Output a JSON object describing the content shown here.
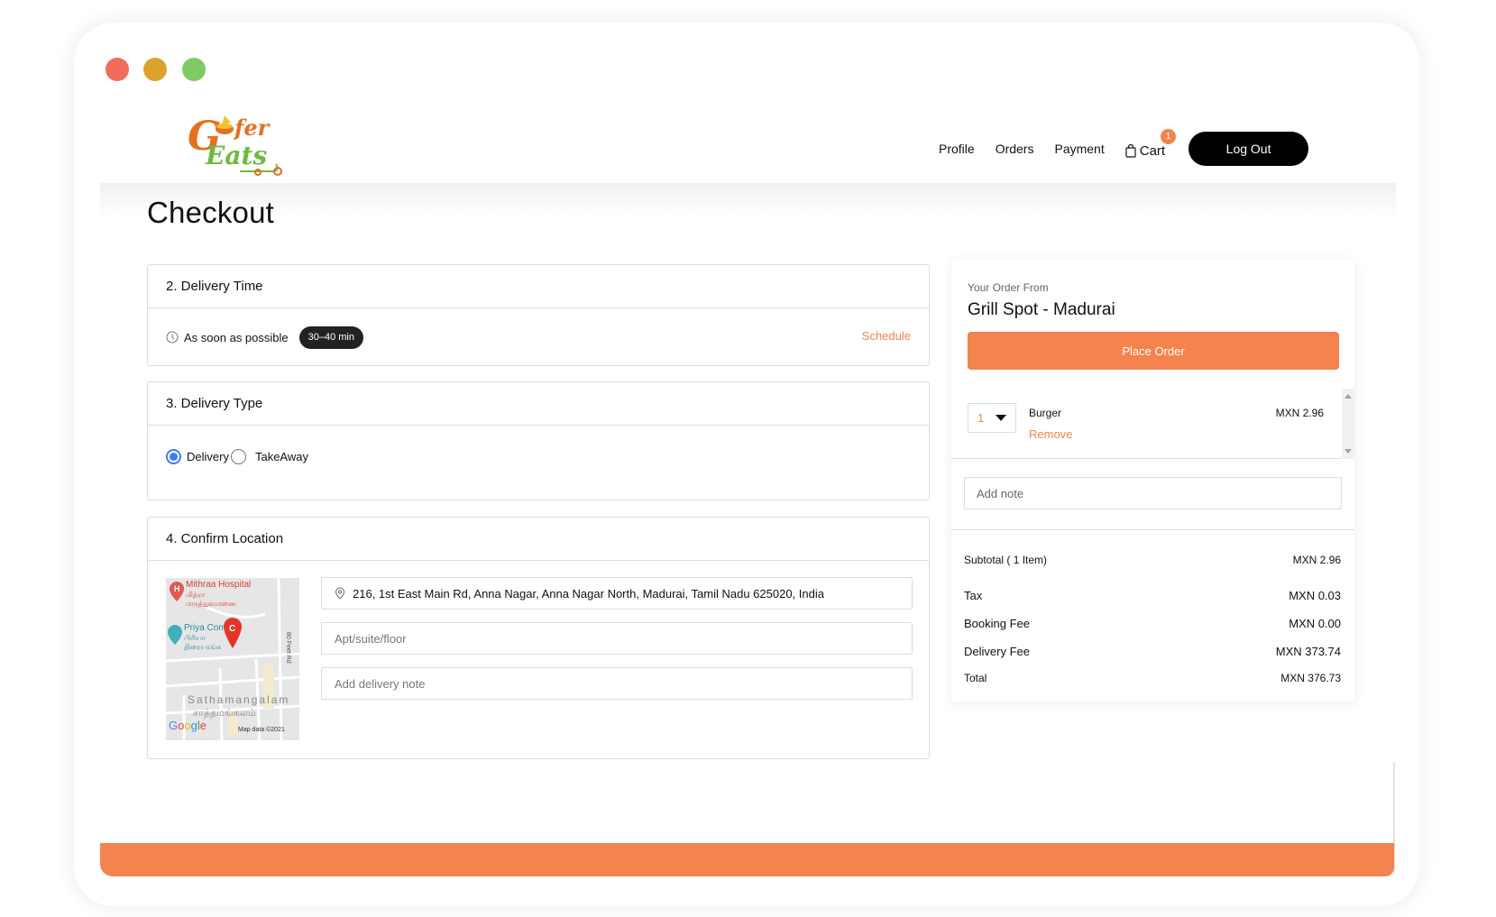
{
  "window": {
    "controls": [
      "close",
      "minimize",
      "maximize"
    ]
  },
  "brand": {
    "logo_line1": "Gofer",
    "logo_line2": "Eats",
    "accent_color": "#f4834d"
  },
  "nav": {
    "profile": "Profile",
    "orders": "Orders",
    "payment": "Payment",
    "cart": "Cart",
    "cart_count": "1",
    "logout": "Log Out"
  },
  "page": {
    "title": "Checkout"
  },
  "delivery_time": {
    "heading": "2. Delivery Time",
    "option": "As soon as possible",
    "eta": "30–40 min",
    "schedule": "Schedule"
  },
  "delivery_type": {
    "heading": "3. Delivery Type",
    "options": [
      {
        "label": "Delivery",
        "selected": true
      },
      {
        "label": "TakeAway",
        "selected": false
      }
    ]
  },
  "location": {
    "heading": "4. Confirm Location",
    "address": "216, 1st East Main Rd, Anna Nagar, Anna Nagar North, Madurai, Tamil Nadu 625020, India",
    "apt_placeholder": "Apt/suite/floor",
    "note_placeholder": "Add delivery note",
    "map": {
      "label_hospital": "Mithraa Hospital",
      "label_hospital_ta": "மித்ரா மருத்துவமனை",
      "label_cinema": "Priya Complex",
      "label_cinema_ta": "பிரியா திரையரங்கம்",
      "label_area": "Sathamangalam",
      "label_area_ta": "சாத்தமங்கலம்",
      "label_road": "80 Feet Rd",
      "marker": "C",
      "google": "Google",
      "attribution": "Map data ©2021"
    }
  },
  "order": {
    "subtitle": "Your Order From",
    "restaurant": "Grill Spot - Madurai",
    "place_order": "Place Order",
    "items": [
      {
        "qty": "1",
        "name": "Burger",
        "price": "MXN 2.96",
        "remove": "Remove"
      }
    ],
    "note_placeholder": "Add note",
    "summary": [
      {
        "label": "Subtotal ( 1 Item)",
        "value": "MXN 2.96"
      },
      {
        "label": "Tax",
        "value": "MXN 0.03"
      },
      {
        "label": "Booking Fee",
        "value": "MXN 0.00"
      },
      {
        "label": "Delivery Fee",
        "value": "MXN 373.74"
      },
      {
        "label": "Total",
        "value": "MXN 376.73"
      }
    ]
  }
}
